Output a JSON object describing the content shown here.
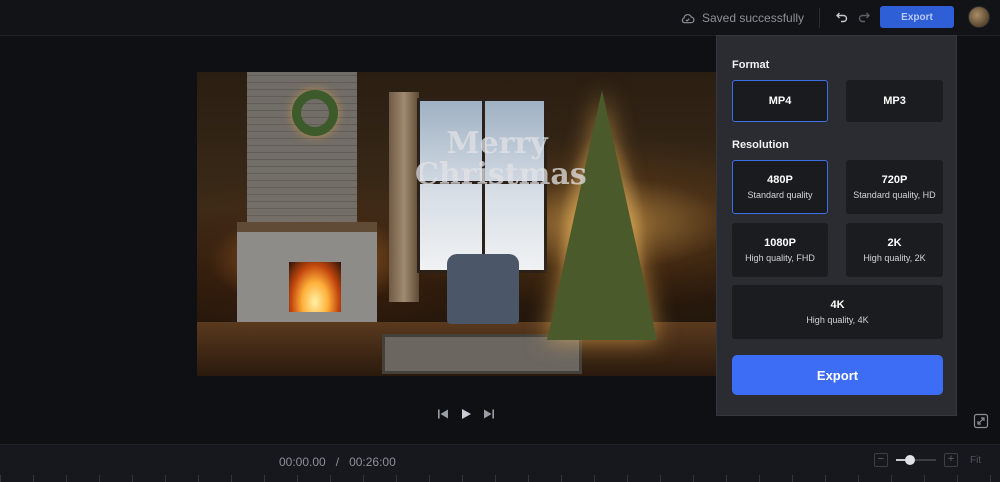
{
  "header": {
    "save_status": "Saved successfully",
    "export_label": "Export",
    "icons": [
      "cloud-check-icon",
      "undo-icon",
      "redo-icon",
      "avatar"
    ]
  },
  "preview": {
    "overlay_text": "Merry Christmas"
  },
  "player": {
    "current_time": "00:00.00",
    "separator": "/",
    "total_time": "00:26:00"
  },
  "zoom": {
    "minus_label": "−",
    "plus_label": "+",
    "fit_label": "Fit",
    "level": 0.35
  },
  "export_panel": {
    "format_title": "Format",
    "formats": [
      {
        "label": "MP4",
        "selected": true
      },
      {
        "label": "MP3",
        "selected": false
      }
    ],
    "resolution_title": "Resolution",
    "resolutions": [
      {
        "label": "480P",
        "desc": "Standard quality",
        "selected": true
      },
      {
        "label": "720P",
        "desc": "Standard quality, HD",
        "selected": false
      },
      {
        "label": "1080P",
        "desc": "High quality, FHD",
        "selected": false
      },
      {
        "label": "2K",
        "desc": "High quality, 2K",
        "selected": false
      },
      {
        "label": "4K",
        "desc": "High quality, 4K",
        "selected": false
      }
    ],
    "export_button": "Export"
  },
  "colors": {
    "accent": "#3c6df4",
    "selected_border": "#3d6fe6",
    "panel_bg": "#2a2c31",
    "app_bg": "#0e1014"
  }
}
